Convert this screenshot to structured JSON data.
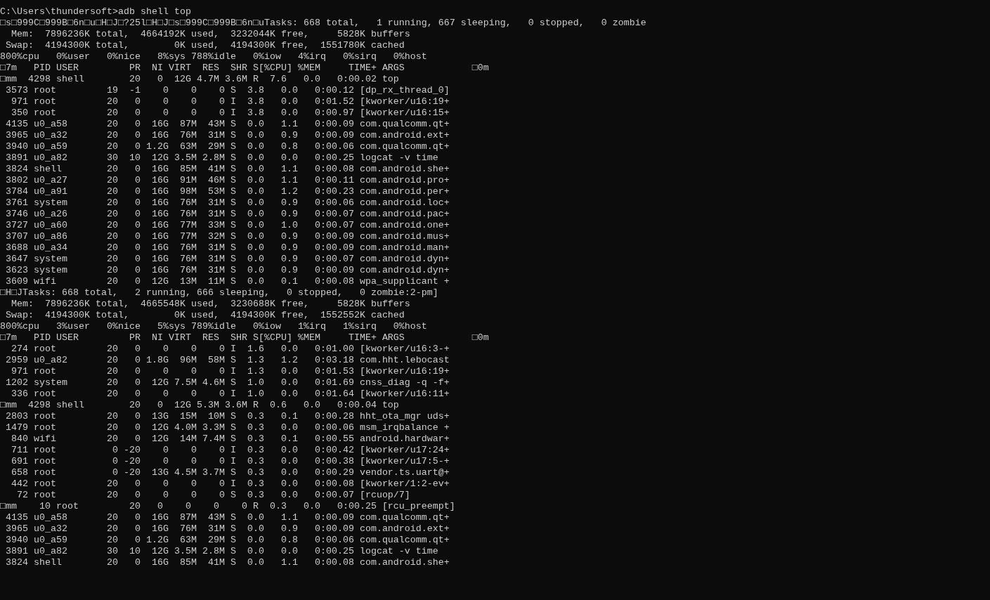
{
  "terminal": {
    "lines": [
      "C:\\Users\\thundersoft>adb shell top",
      "□s□999C□999B□6n□u□H□J□?25l□H□J□s□999C□999B□6n□uTasks: 668 total,   1 running, 667 sleeping,   0 stopped,   0 zombie",
      "  Mem:  7896236K total,  4664192K used,  3232044K free,     5828K buffers",
      " Swap:  4194300K total,        0K used,  4194300K free,  1551780K cached",
      "800%cpu   0%user   0%nice   8%sys 788%idle   0%iow   4%irq   0%sirq   0%host",
      "□7m   PID USER         PR  NI VIRT  RES  SHR S[%CPU] %MEM     TIME+ ARGS            □0m",
      "□mm  4298 shell        20   0  12G 4.7M 3.6M R  7.6   0.0   0:00.02 top",
      " 3573 root         19  -1    0    0    0 S  3.8   0.0   0:00.12 [dp_rx_thread_0]",
      "  971 root         20   0    0    0    0 I  3.8   0.0   0:01.52 [kworker/u16:19+",
      "  350 root         20   0    0    0    0 I  3.8   0.0   0:00.97 [kworker/u16:15+",
      " 4135 u0_a58       20   0  16G  87M  43M S  0.0   1.1   0:00.09 com.qualcomm.qt+",
      " 3965 u0_a32       20   0  16G  76M  31M S  0.0   0.9   0:00.09 com.android.ext+",
      " 3940 u0_a59       20   0 1.2G  63M  29M S  0.0   0.8   0:00.06 com.qualcomm.qt+",
      " 3891 u0_a82       30  10  12G 3.5M 2.8M S  0.0   0.0   0:00.25 logcat -v time",
      " 3824 shell        20   0  16G  85M  41M S  0.0   1.1   0:00.08 com.android.she+",
      " 3802 u0_a27       20   0  16G  91M  46M S  0.0   1.1   0:00.11 com.android.pro+",
      " 3784 u0_a91       20   0  16G  98M  53M S  0.0   1.2   0:00.23 com.android.per+",
      " 3761 system       20   0  16G  76M  31M S  0.0   0.9   0:00.06 com.android.loc+",
      " 3746 u0_a26       20   0  16G  76M  31M S  0.0   0.9   0:00.07 com.android.pac+",
      " 3727 u0_a60       20   0  16G  77M  33M S  0.0   1.0   0:00.07 com.android.one+",
      " 3707 u0_a86       20   0  16G  77M  32M S  0.0   0.9   0:00.09 com.android.mus+",
      " 3688 u0_a34       20   0  16G  76M  31M S  0.0   0.9   0:00.09 com.android.man+",
      " 3647 system       20   0  16G  76M  31M S  0.0   0.9   0:00.07 com.android.dyn+",
      " 3623 system       20   0  16G  76M  31M S  0.0   0.9   0:00.09 com.android.dyn+",
      " 3609 wifi         20   0  12G  13M  11M S  0.0   0.1   0:00.08 wpa_supplicant +",
      "□H□JTasks: 668 total,   2 running, 666 sleeping,   0 stopped,   0 zombie:2-pm]",
      "  Mem:  7896236K total,  4665548K used,  3230688K free,     5828K buffers",
      " Swap:  4194300K total,        0K used,  4194300K free,  1552552K cached",
      "800%cpu   3%user   0%nice   5%sys 789%idle   0%iow   1%irq   1%sirq   0%host",
      "□7m   PID USER         PR  NI VIRT  RES  SHR S[%CPU] %MEM     TIME+ ARGS            □0m",
      "  274 root         20   0    0    0    0 I  1.6   0.0   0:01.00 [kworker/u16:3-+",
      " 2959 u0_a82       20   0 1.8G  96M  58M S  1.3   1.2   0:03.18 com.hht.lebocast",
      "  971 root         20   0    0    0    0 I  1.3   0.0   0:01.53 [kworker/u16:19+",
      " 1202 system       20   0  12G 7.5M 4.6M S  1.0   0.0   0:01.69 cnss_diag -q -f+",
      "  336 root         20   0    0    0    0 I  1.0   0.0   0:01.64 [kworker/u16:11+",
      "□mm  4298 shell        20   0  12G 5.3M 3.6M R  0.6   0.0   0:00.04 top",
      " 2803 root         20   0  13G  15M  10M S  0.3   0.1   0:00.28 hht_ota_mgr uds+",
      " 1479 root         20   0  12G 4.0M 3.3M S  0.3   0.0   0:00.06 msm_irqbalance +",
      "  840 wifi         20   0  12G  14M 7.4M S  0.3   0.1   0:00.55 android.hardwar+",
      "  711 root          0 -20    0    0    0 I  0.3   0.0   0:00.42 [kworker/u17:24+",
      "  691 root          0 -20    0    0    0 I  0.3   0.0   0:00.38 [kworker/u17:5-+",
      "  658 root          0 -20  13G 4.5M 3.7M S  0.3   0.0   0:00.29 vendor.ts.uart@+",
      "  442 root         20   0    0    0    0 I  0.3   0.0   0:00.08 [kworker/1:2-ev+",
      "   72 root         20   0    0    0    0 S  0.3   0.0   0:00.07 [rcuop/7]",
      "□mm    10 root         20   0    0    0    0 R  0.3   0.0   0:00.25 [rcu_preempt]",
      " 4135 u0_a58       20   0  16G  87M  43M S  0.0   1.1   0:00.09 com.qualcomm.qt+",
      " 3965 u0_a32       20   0  16G  76M  31M S  0.0   0.9   0:00.09 com.android.ext+",
      " 3940 u0_a59       20   0 1.2G  63M  29M S  0.0   0.8   0:00.06 com.qualcomm.qt+",
      " 3891 u0_a82       30  10  12G 3.5M 2.8M S  0.0   0.0   0:00.25 logcat -v time",
      " 3824 shell        20   0  16G  85M  41M S  0.0   1.1   0:00.08 com.android.she+"
    ]
  }
}
